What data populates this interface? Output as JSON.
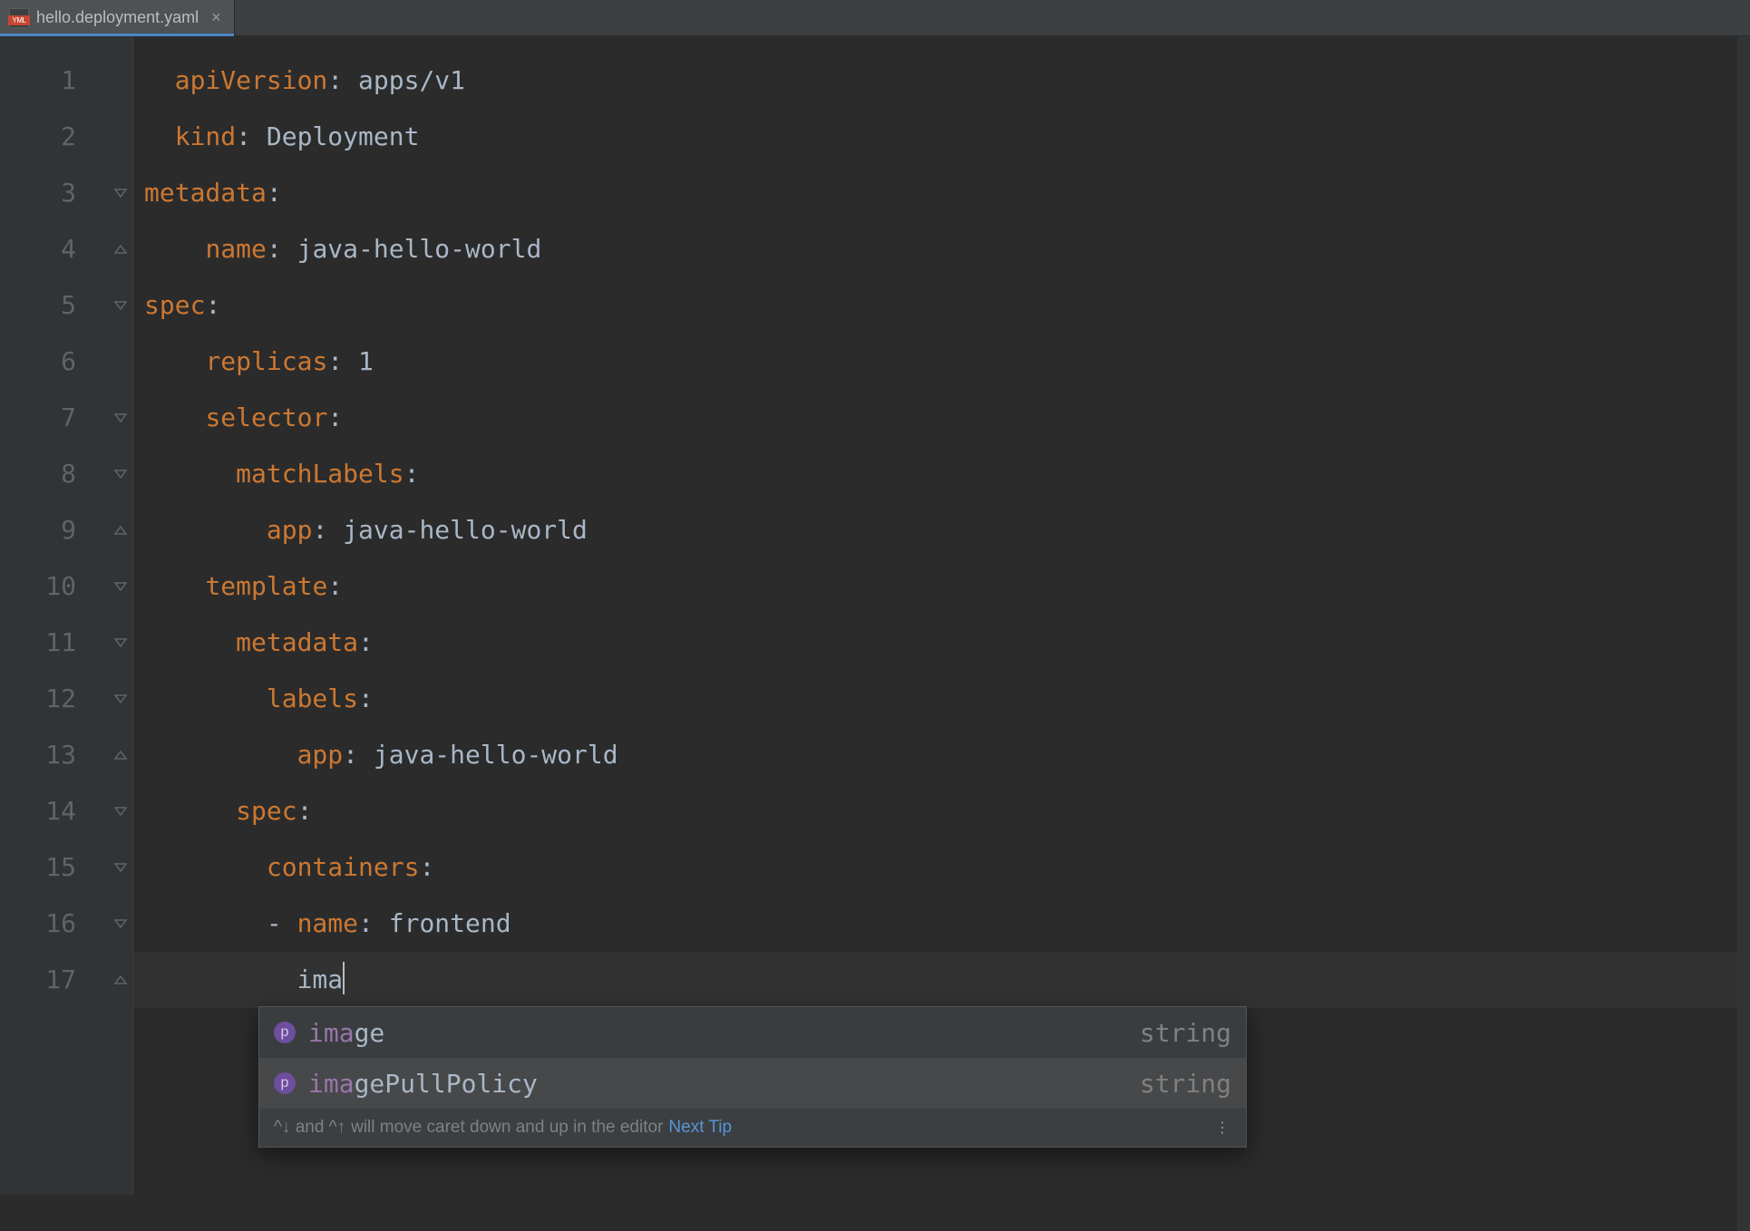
{
  "tab": {
    "filename": "hello.deployment.yaml",
    "icon_label": "YML"
  },
  "lines": [
    {
      "n": 1,
      "fold": "",
      "segs": [
        [
          "key",
          "apiVersion"
        ],
        [
          "val",
          ": apps/v1"
        ]
      ],
      "indent": 0
    },
    {
      "n": 2,
      "fold": "",
      "segs": [
        [
          "key",
          "kind"
        ],
        [
          "val",
          ": Deployment"
        ]
      ],
      "indent": 0
    },
    {
      "n": 3,
      "fold": "open",
      "segs": [
        [
          "key",
          "metadata"
        ],
        [
          "val",
          ":"
        ]
      ],
      "indent": 0,
      "rootish": true
    },
    {
      "n": 4,
      "fold": "close",
      "segs": [
        [
          "key",
          "name"
        ],
        [
          "val",
          ": java-hello-world"
        ]
      ],
      "indent": 1
    },
    {
      "n": 5,
      "fold": "open",
      "segs": [
        [
          "key",
          "spec"
        ],
        [
          "val",
          ":"
        ]
      ],
      "indent": 0,
      "rootish": true
    },
    {
      "n": 6,
      "fold": "",
      "segs": [
        [
          "key",
          "replicas"
        ],
        [
          "val",
          ": 1"
        ]
      ],
      "indent": 1
    },
    {
      "n": 7,
      "fold": "open",
      "segs": [
        [
          "key",
          "selector"
        ],
        [
          "val",
          ":"
        ]
      ],
      "indent": 1
    },
    {
      "n": 8,
      "fold": "open",
      "segs": [
        [
          "key",
          "matchLabels"
        ],
        [
          "val",
          ":"
        ]
      ],
      "indent": 2
    },
    {
      "n": 9,
      "fold": "close",
      "segs": [
        [
          "key",
          "app"
        ],
        [
          "val",
          ": java-hello-world"
        ]
      ],
      "indent": 3
    },
    {
      "n": 10,
      "fold": "open",
      "segs": [
        [
          "key",
          "template"
        ],
        [
          "val",
          ":"
        ]
      ],
      "indent": 1
    },
    {
      "n": 11,
      "fold": "open",
      "segs": [
        [
          "key",
          "metadata"
        ],
        [
          "val",
          ":"
        ]
      ],
      "indent": 2
    },
    {
      "n": 12,
      "fold": "open",
      "segs": [
        [
          "key",
          "labels"
        ],
        [
          "val",
          ":"
        ]
      ],
      "indent": 3
    },
    {
      "n": 13,
      "fold": "close",
      "segs": [
        [
          "key",
          "app"
        ],
        [
          "val",
          ": java-hello-world"
        ]
      ],
      "indent": 4
    },
    {
      "n": 14,
      "fold": "open",
      "segs": [
        [
          "key",
          "spec"
        ],
        [
          "val",
          ":"
        ]
      ],
      "indent": 2
    },
    {
      "n": 15,
      "fold": "open",
      "segs": [
        [
          "key",
          "containers"
        ],
        [
          "val",
          ":"
        ]
      ],
      "indent": 3
    },
    {
      "n": 16,
      "fold": "open",
      "segs": [
        [
          "val",
          "- "
        ],
        [
          "key",
          "name"
        ],
        [
          "val",
          ": frontend"
        ]
      ],
      "indent": 3
    },
    {
      "n": 17,
      "fold": "close",
      "segs": [
        [
          "val",
          "ima"
        ]
      ],
      "indent": 4,
      "caret": true,
      "active": true
    }
  ],
  "popup": {
    "items": [
      {
        "badge": "p",
        "match": "ima",
        "rest": "ge",
        "type": "string",
        "selected": true
      },
      {
        "badge": "p",
        "match": "ima",
        "rest": "gePullPolicy",
        "type": "string",
        "selected": false
      }
    ],
    "footer_keys": "^↓ and ^↑",
    "footer_text": " will move caret down and up in the editor ",
    "footer_link": "Next Tip"
  }
}
